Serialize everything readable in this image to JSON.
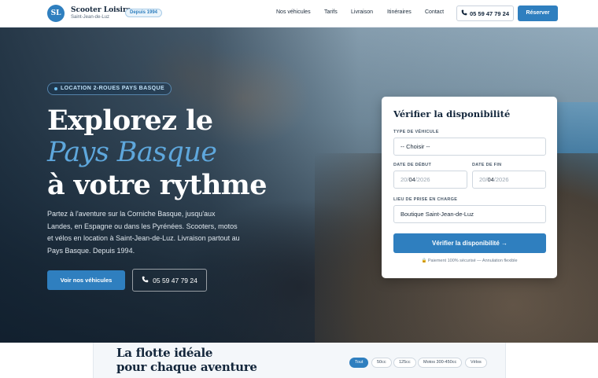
{
  "header": {
    "logo_initials": "SL",
    "brand_name": "Scooter Loisirs",
    "brand_location": "Saint-Jean-de-Luz",
    "since_badge": "Depuis 1994",
    "nav": [
      "Nos véhicules",
      "Tarifs",
      "Livraison",
      "Itinéraires",
      "Contact"
    ],
    "phone_icon": "phone-icon",
    "phone": "05 59 47 79 24",
    "reserve_label": "Réserver"
  },
  "hero": {
    "badge": "LOCATION 2-ROUES PAYS BASQUE",
    "title_line1": "Explorez le",
    "title_line2": "Pays Basque",
    "title_line3": "à votre rythme",
    "description": "Partez à l'aventure sur la Corniche Basque, jusqu'aux Landes, en Espagne ou dans les Pyrénées. Scooters, motos et vélos en location à Saint-Jean-de-Luz. Livraison partout au Pays Basque. Depuis 1994.",
    "primary_button": "Voir nos véhicules",
    "phone_button": "05 59 47 79 24"
  },
  "booking": {
    "title": "Vérifier la disponibilité",
    "vehicle_type_label": "TYPE DE VÉHICULE",
    "vehicle_type_value": "-- Choisir --",
    "start_date_label": "DATE DE DÉBUT",
    "start_date": {
      "day": "20",
      "month": "04",
      "year": "2026"
    },
    "end_date_label": "DATE DE FIN",
    "end_date": {
      "day": "20",
      "month": "04",
      "year": "2026"
    },
    "pickup_label": "LIEU DE PRISE EN CHARGE",
    "pickup_value": "Boutique Saint-Jean-de-Luz",
    "submit_label": "Vérifier la disponibilité →",
    "secure_note": "🔒 Paiement 100% sécurisé — Annulation flexible"
  },
  "fleet": {
    "title_line1": "La flotte idéale",
    "title_line2": "pour chaque aventure",
    "filters": [
      "Tout",
      "50cc",
      "125cc",
      "Motos 300-450cc",
      "Vélos"
    ],
    "active_filter": "Tout"
  },
  "colors": {
    "accent": "#2f7fbf",
    "navy": "#13263b",
    "italic_blue": "#5ea7dc"
  }
}
